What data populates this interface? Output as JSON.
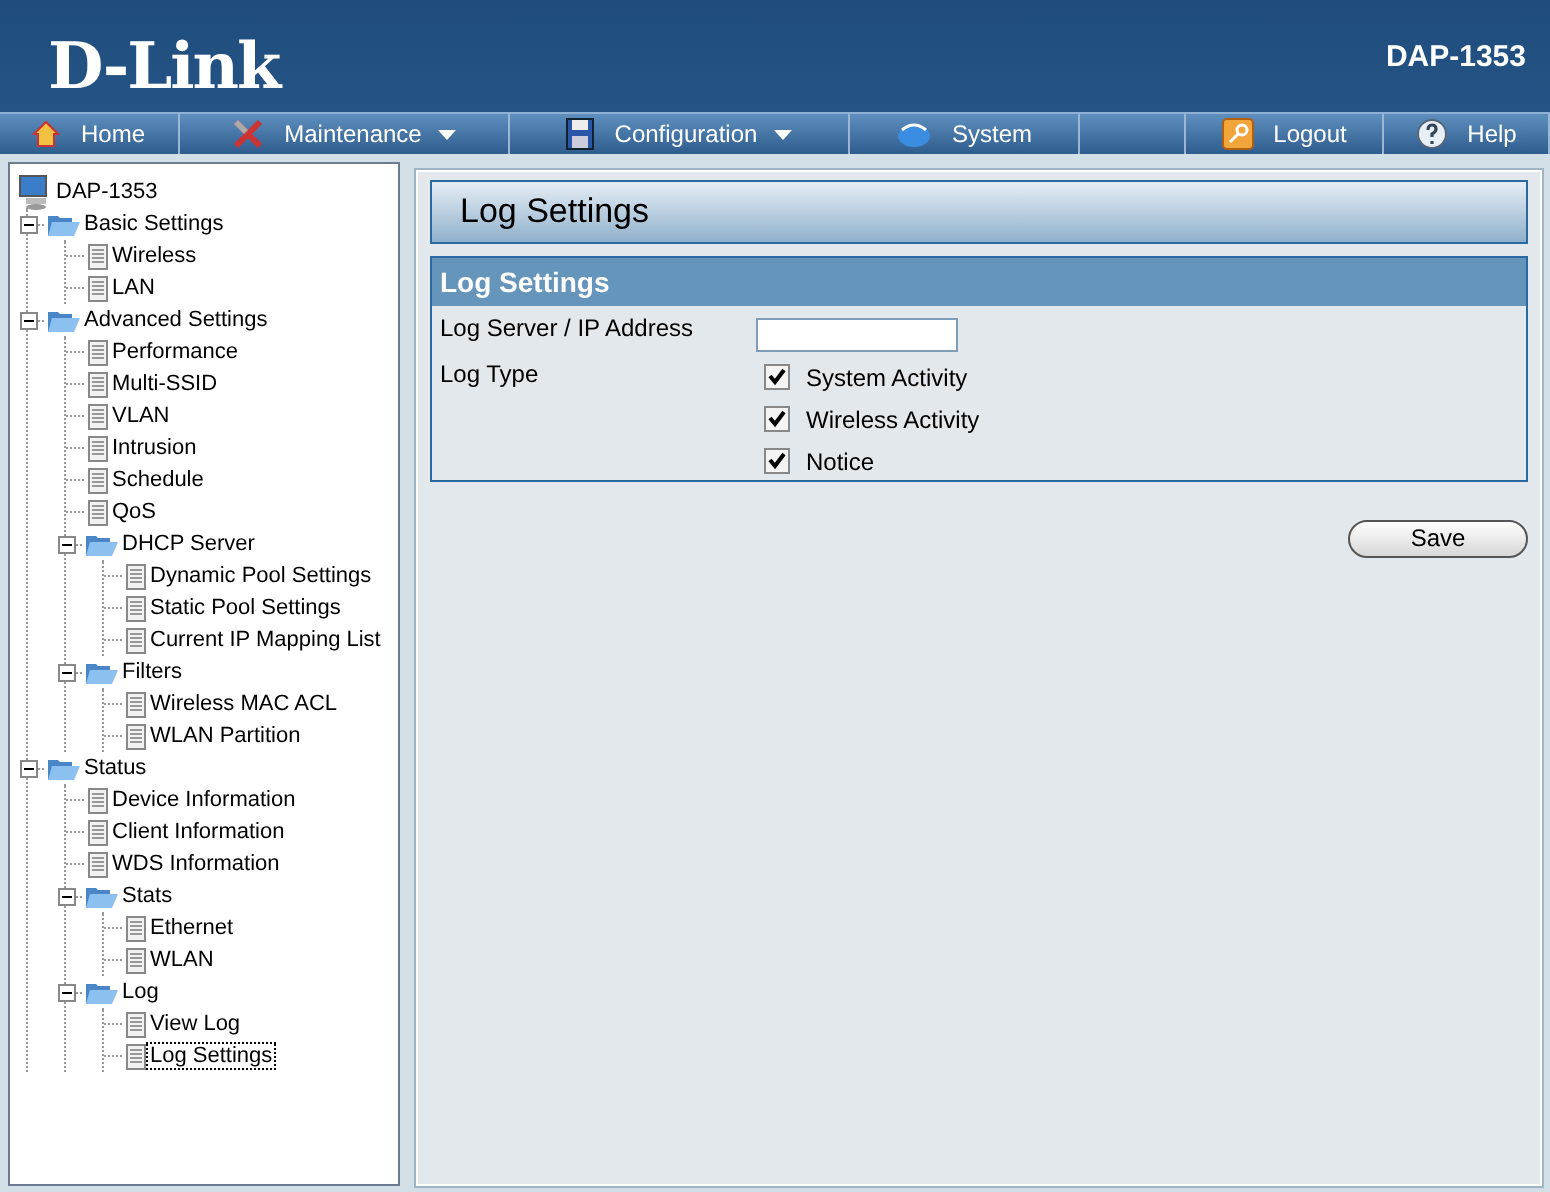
{
  "header": {
    "logo": "D-Link",
    "model": "DAP-1353"
  },
  "nav": [
    {
      "label": "Home",
      "dropdown": false
    },
    {
      "label": "Maintenance",
      "dropdown": true
    },
    {
      "label": "Configuration",
      "dropdown": true
    },
    {
      "label": "System",
      "dropdown": false
    },
    {
      "label": "Logout",
      "dropdown": false
    },
    {
      "label": "Help",
      "dropdown": false
    }
  ],
  "tree": [
    {
      "label": "DAP-1353",
      "kind": "root",
      "selected": false,
      "children": [
        {
          "label": "Basic Settings",
          "kind": "folder",
          "expanded": true,
          "selected": false,
          "children": [
            {
              "label": "Wireless",
              "kind": "page",
              "selected": false
            },
            {
              "label": "LAN",
              "kind": "page",
              "selected": false
            }
          ]
        },
        {
          "label": "Advanced Settings",
          "kind": "folder",
          "expanded": true,
          "selected": false,
          "children": [
            {
              "label": "Performance",
              "kind": "page",
              "selected": false
            },
            {
              "label": "Multi-SSID",
              "kind": "page",
              "selected": false
            },
            {
              "label": "VLAN",
              "kind": "page",
              "selected": false
            },
            {
              "label": "Intrusion",
              "kind": "page",
              "selected": false
            },
            {
              "label": "Schedule",
              "kind": "page",
              "selected": false
            },
            {
              "label": "QoS",
              "kind": "page",
              "selected": false
            },
            {
              "label": "DHCP Server",
              "kind": "folder",
              "expanded": true,
              "selected": false,
              "children": [
                {
                  "label": "Dynamic Pool Settings",
                  "kind": "page",
                  "selected": false
                },
                {
                  "label": "Static Pool Settings",
                  "kind": "page",
                  "selected": false
                },
                {
                  "label": "Current IP Mapping List",
                  "kind": "page",
                  "selected": false
                }
              ]
            },
            {
              "label": "Filters",
              "kind": "folder",
              "expanded": true,
              "selected": false,
              "children": [
                {
                  "label": "Wireless MAC ACL",
                  "kind": "page",
                  "selected": false
                },
                {
                  "label": "WLAN Partition",
                  "kind": "page",
                  "selected": false
                }
              ]
            }
          ]
        },
        {
          "label": "Status",
          "kind": "folder",
          "expanded": true,
          "selected": false,
          "children": [
            {
              "label": "Device Information",
              "kind": "page",
              "selected": false
            },
            {
              "label": "Client Information",
              "kind": "page",
              "selected": false
            },
            {
              "label": "WDS Information",
              "kind": "page",
              "selected": false
            },
            {
              "label": "Stats",
              "kind": "folder",
              "expanded": true,
              "selected": false,
              "children": [
                {
                  "label": "Ethernet",
                  "kind": "page",
                  "selected": false
                },
                {
                  "label": "WLAN",
                  "kind": "page",
                  "selected": false
                }
              ]
            },
            {
              "label": "Log",
              "kind": "folder",
              "expanded": true,
              "selected": false,
              "children": [
                {
                  "label": "View Log",
                  "kind": "page",
                  "selected": false
                },
                {
                  "label": "Log Settings",
                  "kind": "page",
                  "selected": true
                }
              ]
            }
          ]
        }
      ]
    }
  ],
  "page": {
    "title": "Log Settings",
    "section": {
      "title": "Log Settings",
      "server_label": "Log Server / IP Address",
      "type_label": "Log Type",
      "log_types": [
        {
          "label": "System Activity",
          "checked": true
        },
        {
          "label": "Wireless Activity",
          "checked": true
        },
        {
          "label": "Notice",
          "checked": true
        }
      ]
    },
    "save": "Save"
  }
}
